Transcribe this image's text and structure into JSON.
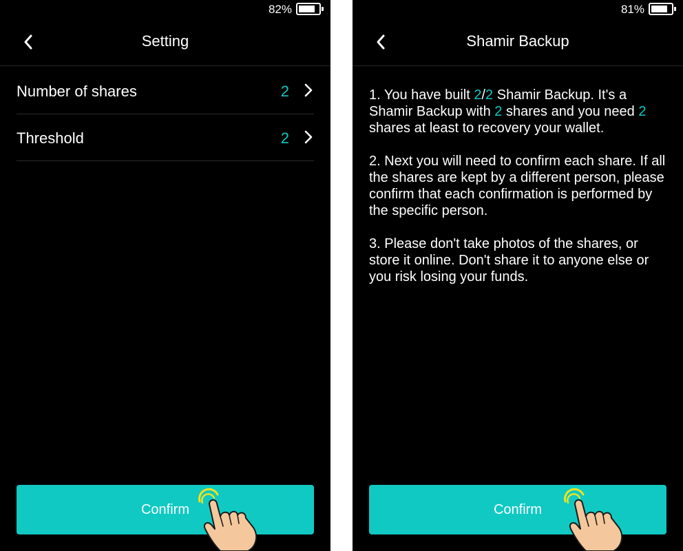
{
  "theme": {
    "accent": "#10c9c3",
    "background": "#000000",
    "text": "#ffffff"
  },
  "left_screen": {
    "status_bar": {
      "battery_text": "82%",
      "battery_level": 0.82
    },
    "nav": {
      "title": "Setting",
      "back_icon": "chevron-left-icon"
    },
    "settings": [
      {
        "label": "Number of shares",
        "value": "2",
        "icon": "chevron-right-icon"
      },
      {
        "label": "Threshold",
        "value": "2",
        "icon": "chevron-right-icon"
      }
    ],
    "confirm_label": "Confirm"
  },
  "right_screen": {
    "status_bar": {
      "battery_text": "81%",
      "battery_level": 0.81
    },
    "nav": {
      "title": "Shamir Backup",
      "back_icon": "chevron-left-icon"
    },
    "instructions": {
      "p1": {
        "before_threshold": "1. You have built ",
        "threshold": "2",
        "slash": "/",
        "total": "2",
        "mid1": " Shamir Backup. It's a Shamir Backup with ",
        "shares": "2",
        "mid2": " shares and you need ",
        "needed": "2",
        "end": " shares at least to recovery your wallet."
      },
      "p2": "2. Next you will need to confirm each share. If all the shares are kept by a different person, please confirm that each confirmation is performed by the specific person.",
      "p3": "3. Please don't take photos of the shares, or store it online. Don't share it to anyone else or you risk losing your funds."
    },
    "confirm_label": "Confirm"
  },
  "overlay": {
    "icon": "tap-hand-icon"
  }
}
